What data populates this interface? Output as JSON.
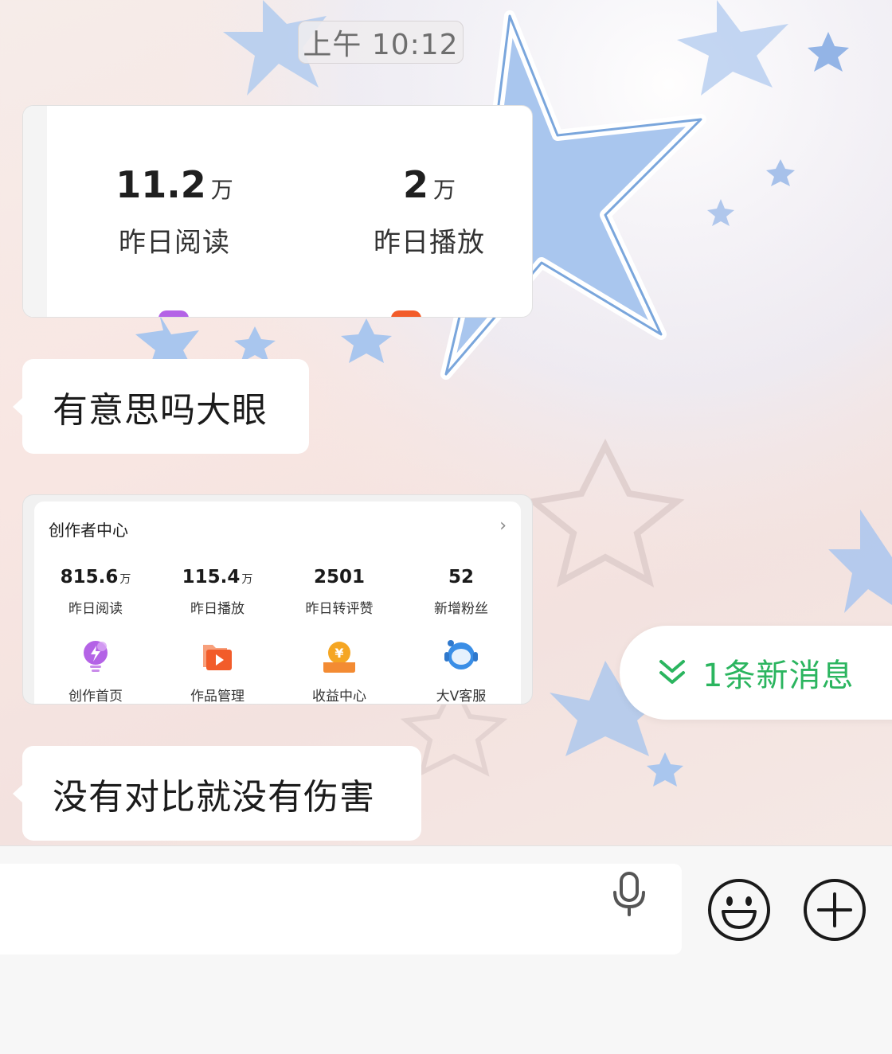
{
  "timestamp": "上午 10:12",
  "stats_image": {
    "stats": [
      {
        "value": "11.2",
        "unit": "万",
        "label": "昨日阅读"
      },
      {
        "value": "2",
        "unit": "万",
        "label": "昨日播放"
      }
    ]
  },
  "messages": [
    {
      "text": "有意思吗大眼"
    },
    {
      "text": "没有对比就没有伤害"
    }
  ],
  "creator_image": {
    "title": "创作者中心",
    "metrics": [
      {
        "value": "815.6",
        "unit": "万",
        "label": "昨日阅读"
      },
      {
        "value": "115.4",
        "unit": "万",
        "label": "昨日播放"
      },
      {
        "value": "2501",
        "unit": "",
        "label": "昨日转评赞"
      },
      {
        "value": "52",
        "unit": "",
        "label": "新增粉丝"
      }
    ],
    "tools": [
      {
        "label": "创作首页",
        "icon": "lightbulb-icon",
        "color": "#b463e6"
      },
      {
        "label": "作品管理",
        "icon": "video-folder-icon",
        "color": "#f25c2a"
      },
      {
        "label": "收益中心",
        "icon": "yuan-coin-icon",
        "color": "#f5a623"
      },
      {
        "label": "大V客服",
        "icon": "robot-headset-icon",
        "color": "#3a8ee6"
      }
    ]
  },
  "new_message_banner": {
    "text": "1条新消息",
    "color": "#2bb55f",
    "icon": "double-chevron-down-icon"
  },
  "input_bar": {
    "icons": [
      "microphone-icon",
      "emoji-icon",
      "plus-icon"
    ]
  }
}
